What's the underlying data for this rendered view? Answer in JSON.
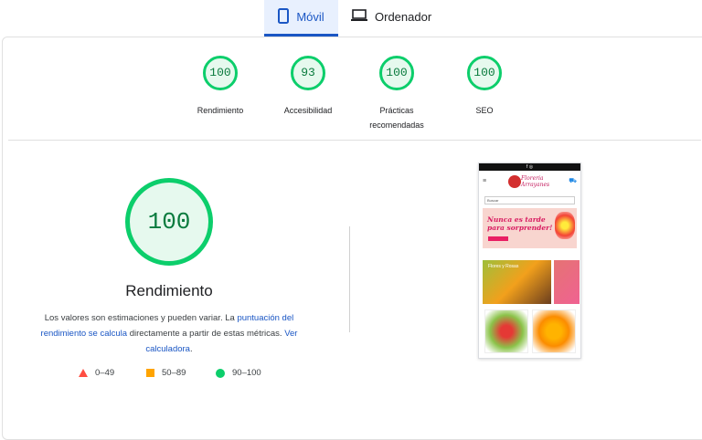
{
  "tabs": [
    {
      "label": "Móvil",
      "icon": "smartphone-icon",
      "active": true
    },
    {
      "label": "Ordenador",
      "icon": "laptop-icon",
      "active": false
    }
  ],
  "gauges": [
    {
      "score": "100",
      "label": "Rendimiento"
    },
    {
      "score": "93",
      "label": "Accesibilidad"
    },
    {
      "score": "100",
      "label": "Prácticas recomendadas"
    },
    {
      "score": "100",
      "label": "SEO"
    }
  ],
  "main": {
    "score": "100",
    "title": "Rendimiento",
    "desc_prefix": "Los valores son estimaciones y pueden variar. La ",
    "desc_link1": "puntuación del rendimiento se calcula",
    "desc_middle": " directamente a partir de estas métricas. ",
    "desc_link2": "Ver calculadora",
    "desc_suffix": "."
  },
  "legend": [
    {
      "range": "0–49",
      "shape": "triangle",
      "color": "#ff4e42"
    },
    {
      "range": "50–89",
      "shape": "square",
      "color": "#ffa400"
    },
    {
      "range": "90–100",
      "shape": "circle",
      "color": "#0cce6b"
    }
  ],
  "thumbnail": {
    "logo_line1": "Floreria",
    "logo_line2": "Arrayanes",
    "search_placeholder": "Buscar",
    "banner_line1": "Nunca es tarde",
    "banner_line2": "para sorprender!",
    "category_label": "Flores y Rosas"
  },
  "colors": {
    "pass": "#0cce6b",
    "average": "#ffa400",
    "fail": "#ff4e42",
    "link": "#1a56c4"
  }
}
